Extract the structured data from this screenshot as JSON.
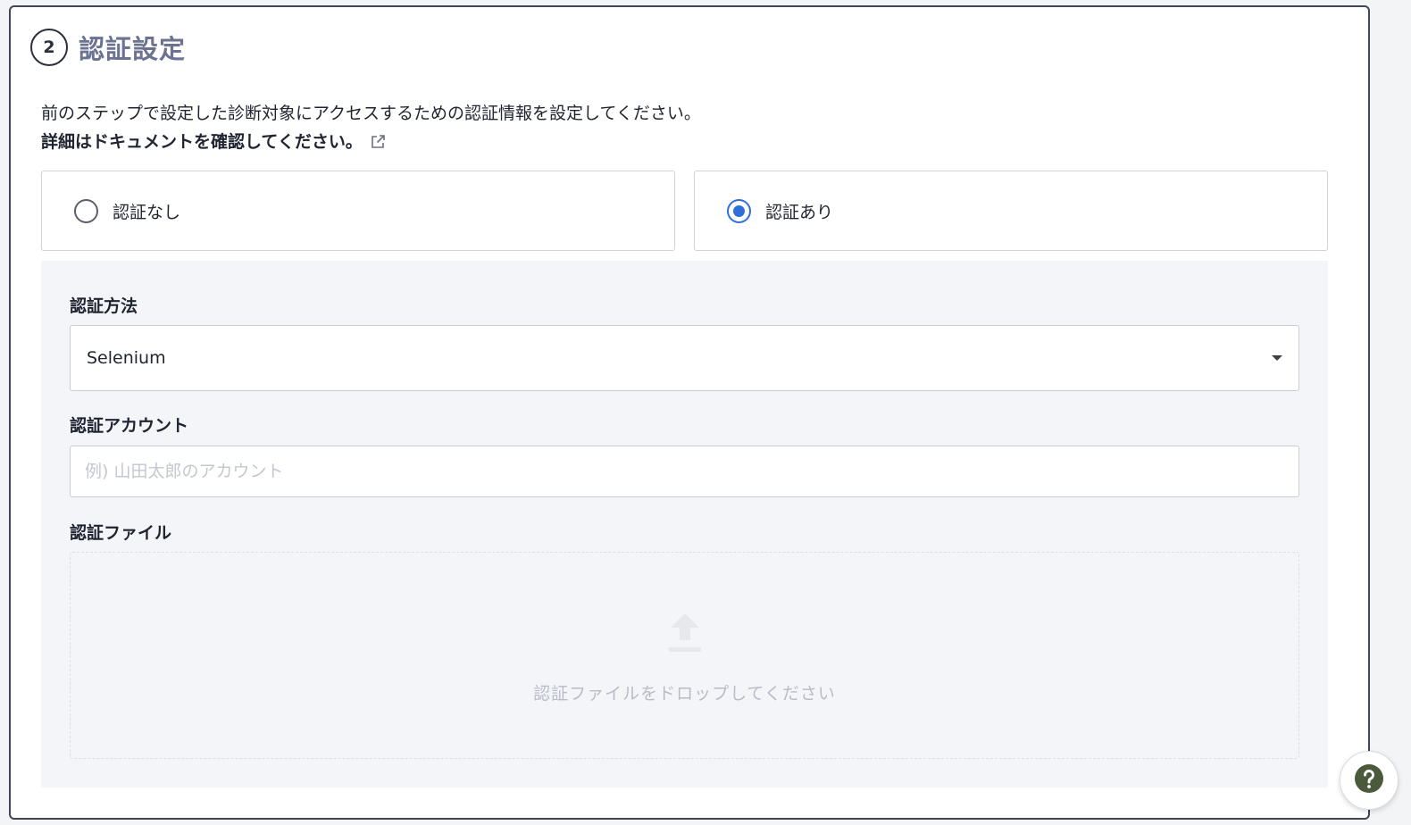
{
  "step": {
    "number": "2",
    "title": "認証設定"
  },
  "description": {
    "line1": "前のステップで設定した診断対象にアクセスするための認証情報を設定してください。",
    "line2": "詳細はドキュメントを確認してください。"
  },
  "auth_options": [
    {
      "label": "認証なし",
      "selected": false
    },
    {
      "label": "認証あり",
      "selected": true
    }
  ],
  "auth_method": {
    "label": "認証方法",
    "selected": "Selenium"
  },
  "auth_account": {
    "label": "認証アカウント",
    "value": "",
    "placeholder": "例) 山田太郎のアカウント"
  },
  "auth_file": {
    "label": "認証ファイル",
    "drop_text": "認証ファイルをドロップしてください"
  },
  "icons": {
    "external_link": "external-link-icon",
    "upload": "upload-icon",
    "help": "help-icon"
  },
  "colors": {
    "accent": "#2f6fd8",
    "title": "#6b7391",
    "panel_bg": "#f3f5f9",
    "help": "#4a5a3a"
  }
}
